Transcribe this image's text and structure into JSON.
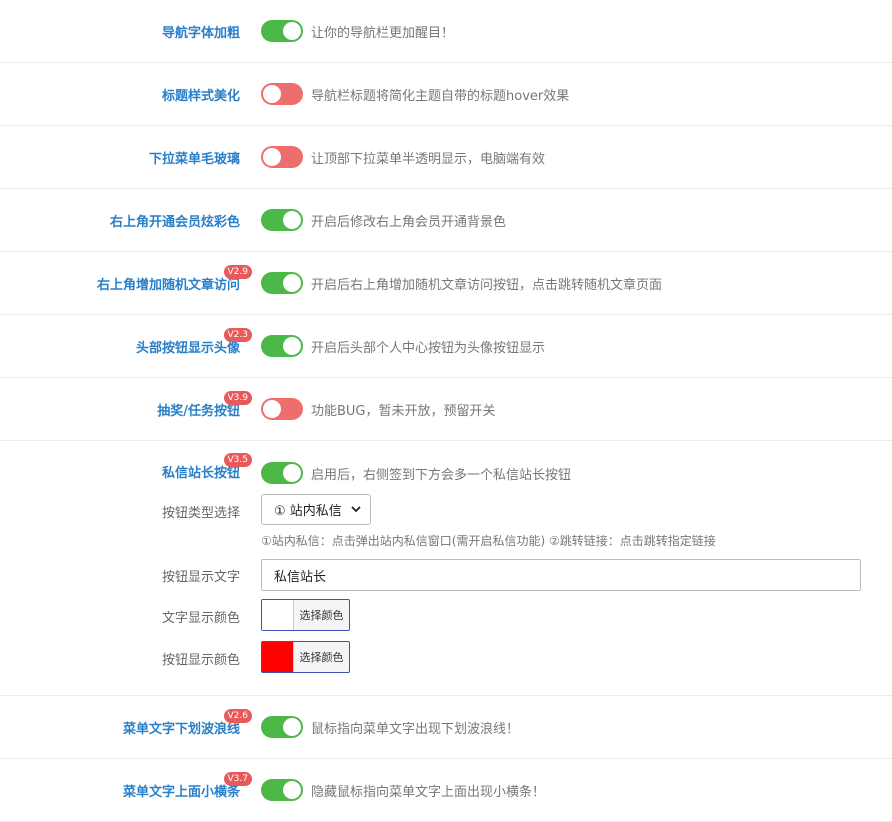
{
  "rows": [
    {
      "label": "导航字体加粗",
      "badge": "",
      "on": true,
      "desc": "让你的导航栏更加醒目！"
    },
    {
      "label": "标题样式美化",
      "badge": "",
      "on": false,
      "desc": "导航栏标题将简化主题自带的标题hover效果"
    },
    {
      "label": "下拉菜单毛玻璃",
      "badge": "",
      "on": false,
      "desc": "让顶部下拉菜单半透明显示，电脑端有效"
    },
    {
      "label": "右上角开通会员炫彩色",
      "badge": "",
      "on": true,
      "desc": "开启后修改右上角会员开通背景色"
    },
    {
      "label": "右上角增加随机文章访问",
      "badge": "V2.9",
      "on": true,
      "desc": "开启后右上角增加随机文章访问按钮，点击跳转随机文章页面"
    },
    {
      "label": "头部按钮显示头像",
      "badge": "V2.3",
      "on": true,
      "desc": "开启后头部个人中心按钮为头像按钮显示"
    },
    {
      "label": "抽奖/任务按钮",
      "badge": "V3.9",
      "on": false,
      "desc": "功能BUG，暂未开放，预留开关"
    }
  ],
  "group": {
    "label": "私信站长按钮",
    "badge": "V3.5",
    "on": true,
    "desc": "启用后，右侧签到下方会多一个私信站长按钮",
    "type_label": "按钮类型选择",
    "type_value": "① 站内私信",
    "type_hint": "①站内私信：点击弹出站内私信窗口(需开启私信功能) ②跳转链接：点击跳转指定链接",
    "text_label": "按钮显示文字",
    "text_value": "私信站长",
    "text_color_label": "文字显示颜色",
    "text_color": "#ffffff",
    "btn_color_label": "按钮显示颜色",
    "btn_color": "#ff0000",
    "pick_label": "选择颜色"
  },
  "rows2": [
    {
      "label": "菜单文字下划波浪线",
      "badge": "V2.6",
      "on": true,
      "desc": "鼠标指向菜单文字出现下划波浪线！"
    },
    {
      "label": "菜单文字上面小横条",
      "badge": "V3.7",
      "on": true,
      "desc": "隐藏鼠标指向菜单文字上面出现小横条！"
    }
  ],
  "colors": {
    "on": "#4cb848",
    "off": "#ee6e6e",
    "label": "#2a7fc9",
    "badge": "#e85a5a"
  }
}
